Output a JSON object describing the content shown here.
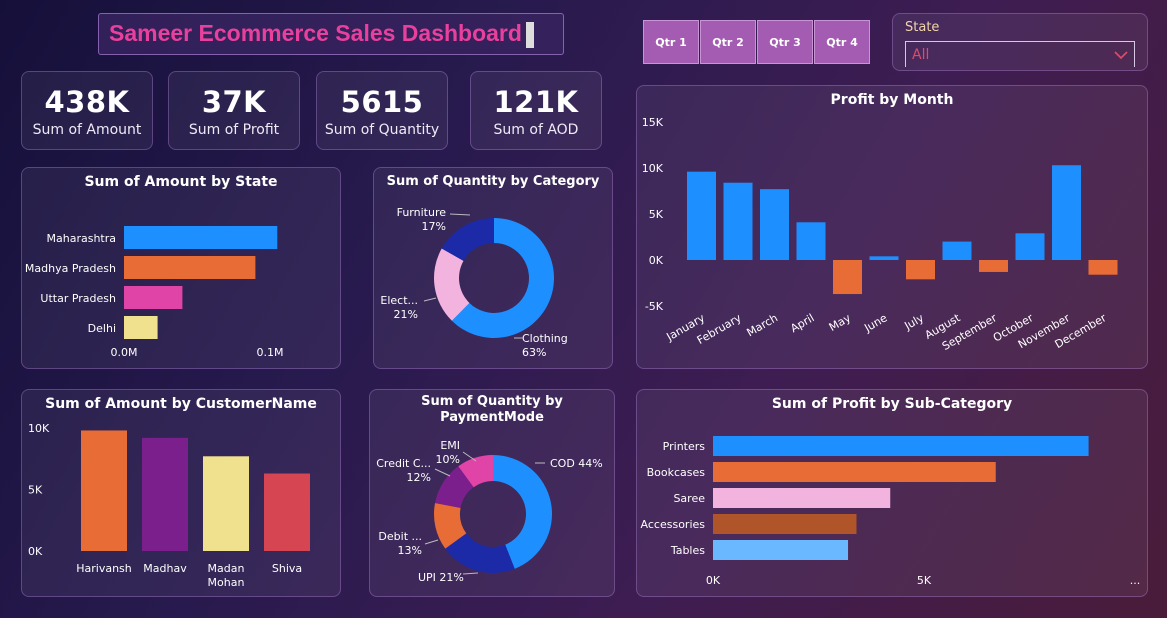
{
  "header": {
    "title": "Sameer Ecommerce Sales Dashboard"
  },
  "quarters": [
    "Qtr 1",
    "Qtr 2",
    "Qtr 3",
    "Qtr 4"
  ],
  "state_filter": {
    "label": "State",
    "value": "All"
  },
  "kpis": [
    {
      "value": "438K",
      "label": "Sum of Amount"
    },
    {
      "value": "37K",
      "label": "Sum of Profit"
    },
    {
      "value": "5615",
      "label": "Sum of Quantity"
    },
    {
      "value": "121K",
      "label": "Sum of AOD"
    }
  ],
  "colors": {
    "accent": "#e8409c",
    "blue": "#1e8fff",
    "orange": "#e76c36",
    "pink": "#e044a7",
    "yellow": "#f0e18e",
    "navy": "#1c2aa8",
    "lightpink": "#f2b4de",
    "purple": "#7b1f8c",
    "red": "#d64552",
    "lightblue": "#6ab8ff",
    "brown": "#b05429"
  },
  "chart_data": [
    {
      "id": "amount_by_state",
      "type": "bar",
      "orientation": "horizontal",
      "title": "Sum of Amount by State",
      "categories": [
        "Maharashtra",
        "Madhya Pradesh",
        "Uttar Pradesh",
        "Delhi"
      ],
      "values": [
        0.105,
        0.09,
        0.04,
        0.023
      ],
      "unit": "M",
      "colors": [
        "#1e8fff",
        "#e76c36",
        "#e044a7",
        "#f0e18e"
      ],
      "xticks": [
        "0.0M",
        "0.1M"
      ],
      "xlim": [
        0,
        0.1
      ]
    },
    {
      "id": "quantity_by_category",
      "type": "pie",
      "donut": true,
      "title": "Sum of Quantity by Category",
      "labels": [
        "Clothing",
        "Electronics",
        "Furniture"
      ],
      "display_labels": [
        "Clothing",
        "Elect...",
        "Furniture"
      ],
      "values": [
        63,
        21,
        17
      ],
      "value_labels": [
        "63%",
        "21%",
        "17%"
      ],
      "colors": [
        "#1e8fff",
        "#f2b4de",
        "#1c2aa8"
      ]
    },
    {
      "id": "profit_by_month",
      "type": "bar",
      "title": "Profit by Month",
      "categories": [
        "January",
        "February",
        "March",
        "April",
        "May",
        "June",
        "July",
        "August",
        "September",
        "October",
        "November",
        "December"
      ],
      "values": [
        9600,
        8400,
        7700,
        4100,
        -3700,
        400,
        -2100,
        2000,
        -1300,
        2900,
        10300,
        -1600
      ],
      "pos_color": "#1e8fff",
      "neg_color": "#e76c36",
      "yticks": [
        "15K",
        "10K",
        "5K",
        "0K",
        "-5K"
      ],
      "ylim": [
        -5000,
        15000
      ]
    },
    {
      "id": "amount_by_customer",
      "type": "bar",
      "title": "Sum of Amount by CustomerName",
      "categories": [
        "Harivansh",
        "Madhav",
        "Madan Mohan",
        "Shiva"
      ],
      "category_lines": [
        [
          "Harivansh"
        ],
        [
          "Madhav"
        ],
        [
          "Madan",
          "Mohan"
        ],
        [
          "Shiva"
        ]
      ],
      "values": [
        9800,
        9200,
        7700,
        6300
      ],
      "colors": [
        "#e76c36",
        "#7b1f8c",
        "#f0e18e",
        "#d64552"
      ],
      "yticks": [
        "10K",
        "5K",
        "0K"
      ],
      "ylim": [
        0,
        10000
      ]
    },
    {
      "id": "quantity_by_paymentmode",
      "type": "pie",
      "donut": true,
      "title": "Sum of Quantity by PaymentMode",
      "title_lines": [
        "Sum of Quantity by",
        "PaymentMode"
      ],
      "labels": [
        "COD",
        "UPI",
        "Debit Card",
        "Credit Card",
        "EMI"
      ],
      "display_labels": [
        "COD",
        "UPI",
        "Debit ...",
        "Credit C...",
        "EMI"
      ],
      "values": [
        44,
        21,
        13,
        12,
        10
      ],
      "value_labels": [
        "44%",
        "21%",
        "13%",
        "12%",
        "10%"
      ],
      "colors": [
        "#1e8fff",
        "#1c2aa8",
        "#e76c36",
        "#7b1f8c",
        "#e044a7"
      ]
    },
    {
      "id": "profit_by_subcategory",
      "type": "bar",
      "orientation": "horizontal",
      "title": "Sum of Profit by Sub-Category",
      "categories": [
        "Printers",
        "Bookcases",
        "Saree",
        "Accessories",
        "Tables"
      ],
      "values": [
        8900,
        6700,
        4200,
        3400,
        3200
      ],
      "colors": [
        "#1e8fff",
        "#e76c36",
        "#f2b4de",
        "#b05429",
        "#6ab8ff"
      ],
      "xticks": [
        "0K",
        "5K"
      ],
      "xlim": [
        0,
        5000
      ],
      "more_label": "..."
    }
  ]
}
